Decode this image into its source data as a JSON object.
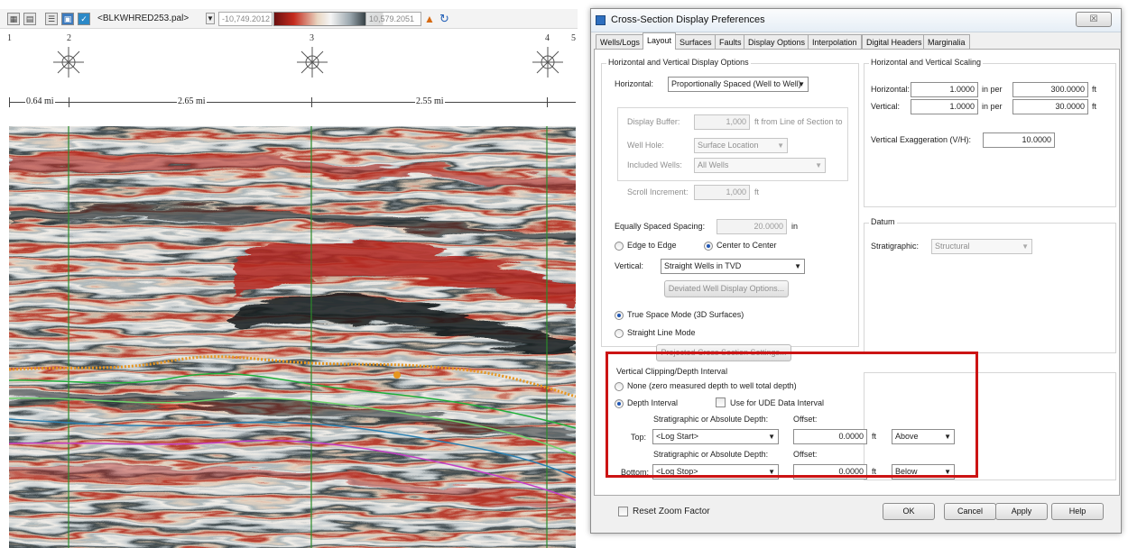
{
  "toolbar": {
    "palette_name": "<BLKWHRED253.pal>",
    "color_min": "-10,749.2012",
    "color_max": "10,579.2051",
    "colors": {
      "deep_red": "#b3261e",
      "white": "#f5f5f5",
      "black": "#101414"
    }
  },
  "section": {
    "well_numbers": [
      "1",
      "2",
      "3",
      "4",
      "5"
    ],
    "distances": [
      "0.64 mi",
      "2.65 mi",
      "2.55 mi"
    ],
    "horizon_colors": [
      "#e7951f",
      "#1fae3a",
      "#6fd36b",
      "#2a7fb0",
      "#c43fc7"
    ]
  },
  "dialog": {
    "title": "Cross-Section Display Preferences",
    "close_symbol": "☒",
    "tabs": [
      "Wells/Logs",
      "Layout",
      "Surfaces",
      "Faults",
      "Display Options",
      "Interpolation",
      "Digital Headers",
      "Marginalia"
    ],
    "active_tab": "Layout",
    "hv_display": {
      "group": "Horizontal and Vertical Display Options",
      "horizontal_label": "Horizontal:",
      "horizontal_value": "Proportionally Spaced (Well to Well)",
      "display_buffer_label": "Display Buffer:",
      "display_buffer_value": "1,000",
      "display_buffer_suffix": "ft  from Line of Section to",
      "well_hole_label": "Well Hole:",
      "well_hole_value": "Surface Location",
      "included_wells_label": "Included Wells:",
      "included_wells_value": "All Wells",
      "scroll_increment_label": "Scroll Increment:",
      "scroll_increment_value": "1,000",
      "scroll_increment_unit": "ft",
      "equal_spacing_label": "Equally Spaced Spacing:",
      "equal_spacing_value": "20.0000",
      "equal_spacing_unit": "in",
      "edge_to_edge": "Edge to Edge",
      "center_to_center": "Center to Center",
      "vertical_label": "Vertical:",
      "vertical_value": "Straight Wells in TVD",
      "deviated_button": "Deviated Well Display Options...",
      "true_space": "True Space Mode (3D Surfaces)",
      "straight_line": "Straight Line Mode",
      "projected_button": "Projected Cross Section Settings..."
    },
    "scaling": {
      "group": "Horizontal and Vertical Scaling",
      "horizontal_label": "Horizontal:",
      "h_in": "1.0000",
      "h_ft": "300.0000",
      "vertical_label": "Vertical:",
      "v_in": "1.0000",
      "v_ft": "30.0000",
      "in_per": "in   per",
      "ft": "ft",
      "exaggeration_label": "Vertical Exaggeration (V/H):",
      "exaggeration_value": "10.0000"
    },
    "datum": {
      "group": "Datum",
      "stratigraphic_label": "Stratigraphic:",
      "stratigraphic_value": "Structural"
    },
    "clipping": {
      "group": "Vertical Clipping/Depth Interval",
      "none_option": "None (zero measured depth to well total depth)",
      "depth_interval": "Depth Interval",
      "use_ude": "Use for UDE Data Interval",
      "strat_abs_label": "Stratigraphic or Absolute Depth:",
      "offset_label": "Offset:",
      "top_label": "Top:",
      "top_value": "<Log Start>",
      "top_offset": "0.0000",
      "top_dir": "Above",
      "bottom_label": "Bottom:",
      "bottom_value": "<Log Stop>",
      "bottom_offset": "0.0000",
      "bottom_dir": "Below",
      "ft": "ft"
    },
    "reset_zoom": "Reset Zoom Factor",
    "buttons": {
      "ok": "OK",
      "cancel": "Cancel",
      "apply": "Apply",
      "help": "Help"
    }
  }
}
